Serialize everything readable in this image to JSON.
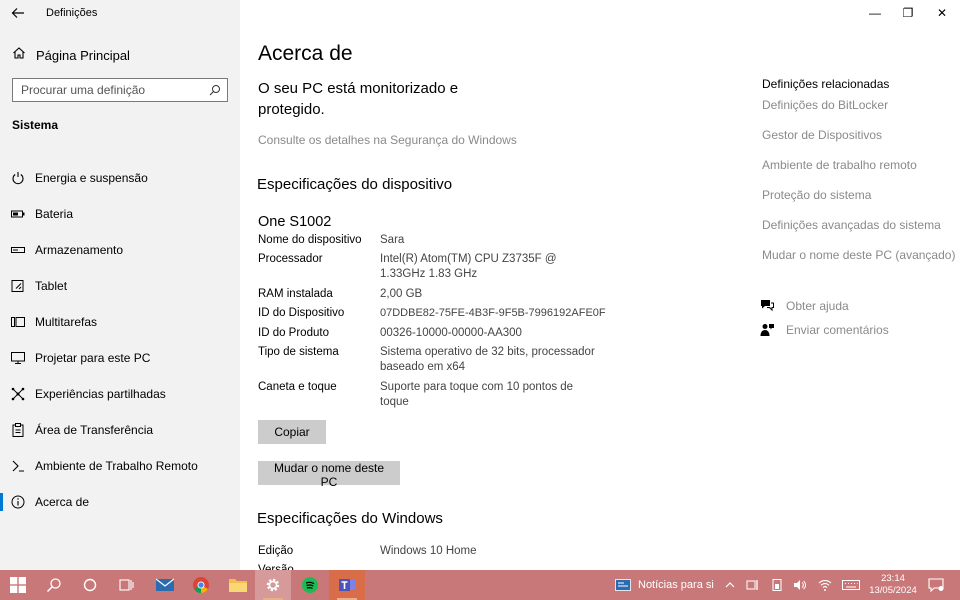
{
  "window": {
    "title": "Definições",
    "controls": {
      "minimize": "—",
      "restore": "❐",
      "close": "✕"
    }
  },
  "sidebar": {
    "home_label": "Página Principal",
    "search": {
      "placeholder": "Procurar uma definição",
      "value": ""
    },
    "section": "Sistema",
    "items": [
      {
        "label": "Energia e suspensão",
        "icon": "power-icon"
      },
      {
        "label": "Bateria",
        "icon": "battery-icon"
      },
      {
        "label": "Armazenamento",
        "icon": "storage-icon"
      },
      {
        "label": "Tablet",
        "icon": "tablet-icon"
      },
      {
        "label": "Multitarefas",
        "icon": "multitasking-icon"
      },
      {
        "label": "Projetar para este PC",
        "icon": "project-icon"
      },
      {
        "label": "Experiências partilhadas",
        "icon": "shared-experiences-icon"
      },
      {
        "label": "Área de Transferência",
        "icon": "clipboard-icon"
      },
      {
        "label": "Ambiente de Trabalho Remoto",
        "icon": "remote-desktop-icon"
      },
      {
        "label": "Acerca de",
        "icon": "info-icon",
        "selected": true
      }
    ]
  },
  "main": {
    "title": "Acerca de",
    "protection_text": "O seu PC está monitorizado e protegido.",
    "security_link": "Consulte os detalhes na Segurança do Windows",
    "device_specs_title": "Especificações do dispositivo",
    "device_name": "One S1002",
    "device_specs": [
      {
        "key": "Nome do dispositivo",
        "value": "Sara"
      },
      {
        "key": "Processador",
        "value": "Intel(R) Atom(TM) CPU  Z3735F @ 1.33GHz 1.83 GHz"
      },
      {
        "key": "RAM instalada",
        "value": "2,00 GB"
      },
      {
        "key": "ID do Dispositivo",
        "value": "07DDBE82-75FE-4B3F-9F5B-7996192AFE0F"
      },
      {
        "key": "ID do Produto",
        "value": "00326-10000-00000-AA300"
      },
      {
        "key": "Tipo de sistema",
        "value": "Sistema operativo de 32 bits, processador baseado em x64"
      },
      {
        "key": "Caneta e toque",
        "value": "Suporte para toque com 10 pontos de toque"
      }
    ],
    "copy_button": "Copiar",
    "rename_button": "Mudar o nome deste PC",
    "windows_specs_title": "Especificações do Windows",
    "windows_specs": [
      {
        "key": "Edição",
        "value": "Windows 10 Home"
      },
      {
        "key": "Versão",
        "value": ""
      }
    ]
  },
  "related": {
    "title": "Definições relacionadas",
    "links": [
      "Definições do BitLocker",
      "Gestor de Dispositivos",
      "Ambiente de trabalho remoto",
      "Proteção do sistema",
      "Definições avançadas do sistema",
      "Mudar o nome deste PC (avançado)"
    ],
    "help": "Obter ajuda",
    "feedback": "Enviar comentários"
  },
  "taskbar": {
    "news": "Notícias para si",
    "time": "23:14",
    "date": "13/05/2024",
    "colors": {
      "background": "#c9787a",
      "accent": "#0078d4"
    }
  }
}
